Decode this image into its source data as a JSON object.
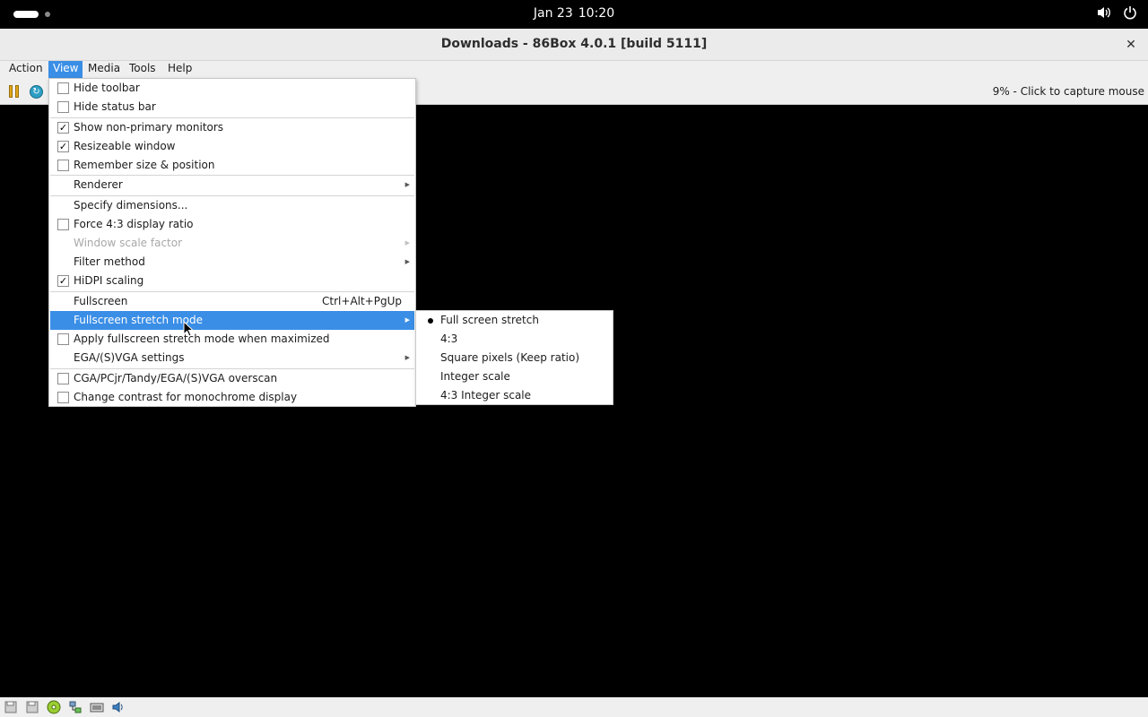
{
  "topbar": {
    "date": "Jan 23",
    "time": "10:20",
    "icons": [
      "activities-icon",
      "volume-icon",
      "power-icon"
    ]
  },
  "window": {
    "title": "Downloads - 86Box 4.0.1 [build 5111]",
    "close_label": "✕"
  },
  "menubar": {
    "items": [
      {
        "label": "Action"
      },
      {
        "label": "View",
        "active": true
      },
      {
        "label": "Media"
      },
      {
        "label": "Tools"
      },
      {
        "label": "Help"
      }
    ]
  },
  "toolbar": {
    "status_text": "9% - Click to capture mouse",
    "icons": [
      "pause-icon",
      "reset-icon"
    ]
  },
  "view_menu": {
    "items": [
      {
        "label": "Hide toolbar",
        "checkbox": true,
        "checked": false
      },
      {
        "label": "Hide status bar",
        "checkbox": true,
        "checked": false
      },
      {
        "label": "Show non-primary monitors",
        "checkbox": true,
        "checked": true
      },
      {
        "label": "Resizeable window",
        "checkbox": true,
        "checked": true
      },
      {
        "label": "Remember size & position",
        "checkbox": true,
        "checked": false
      },
      {
        "label": "Renderer",
        "submenu": true
      },
      {
        "label": "Specify dimensions..."
      },
      {
        "label": "Force 4:3 display ratio",
        "checkbox": true,
        "checked": false
      },
      {
        "label": "Window scale factor",
        "submenu": true,
        "disabled": true
      },
      {
        "label": "Filter method",
        "submenu": true
      },
      {
        "label": "HiDPI scaling",
        "checkbox": true,
        "checked": true
      },
      {
        "label": "Fullscreen",
        "shortcut": "Ctrl+Alt+PgUp"
      },
      {
        "label": "Fullscreen stretch mode",
        "submenu": true,
        "highlighted": true
      },
      {
        "label": "Apply fullscreen stretch mode when maximized",
        "checkbox": true,
        "checked": false
      },
      {
        "label": "EGA/(S)VGA settings",
        "submenu": true
      },
      {
        "label": "CGA/PCjr/Tandy/EGA/(S)VGA overscan",
        "checkbox": true,
        "checked": false
      },
      {
        "label": "Change contrast for monochrome display",
        "checkbox": true,
        "checked": false
      }
    ]
  },
  "stretch_submenu": {
    "items": [
      {
        "label": "Full screen stretch",
        "selected": true
      },
      {
        "label": "4:3",
        "selected": false
      },
      {
        "label": "Square pixels (Keep ratio)",
        "selected": false
      },
      {
        "label": "Integer scale",
        "selected": false
      },
      {
        "label": "4:3 Integer scale",
        "selected": false
      }
    ]
  },
  "statusbar": {
    "icons": [
      "floppy-1-icon",
      "floppy-2-icon",
      "cdrom-icon",
      "network-icon",
      "keyboard-icon",
      "sound-icon"
    ]
  },
  "colors": {
    "accent": "#3a8ee6",
    "display_bg": "#000000",
    "chrome_bg": "#efefef"
  }
}
